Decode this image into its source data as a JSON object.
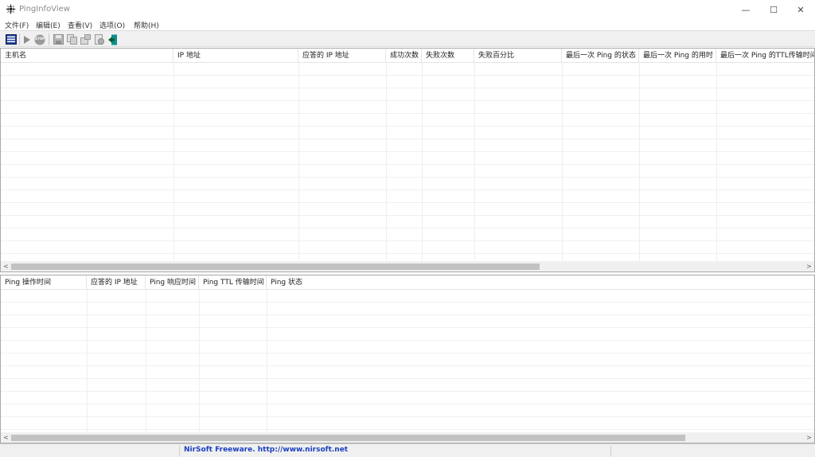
{
  "window": {
    "title": "PingInfoView",
    "minimize_glyph": "—",
    "maximize_glyph": "☐",
    "close_glyph": "✕"
  },
  "menu": [
    "文件(F)",
    "编辑(E)",
    "查看(V)",
    "选项(O)",
    "帮助(H)"
  ],
  "toolbar": {
    "icons": [
      "ping-options-icon",
      "start-icon",
      "stop-icon",
      "save-icon",
      "copy-icon",
      "properties-icon",
      "html-report-icon",
      "exit-icon"
    ],
    "stop_label": "STOP"
  },
  "top_table": {
    "columns": [
      "主机名",
      "IP 地址",
      "应答的 IP 地址",
      "成功次数",
      "失败次数",
      "失败百分比",
      "最后一次 Ping 的状态",
      "最后一次 Ping 的用时",
      "最后一次 Ping 的TTL传输时间"
    ]
  },
  "bottom_table": {
    "columns": [
      "Ping 操作时间",
      "应答的 IP 地址",
      "Ping 响应时间",
      "Ping TTL 传输时间",
      "Ping 状态"
    ]
  },
  "scroll_glyphs": {
    "left": "<",
    "right": ">"
  },
  "status": {
    "text": "NirSoft Freeware.  http://www.nirsoft.net"
  },
  "colors": {
    "link": "#1a3fbf",
    "toolbar_bg": "#f0f0f0"
  }
}
